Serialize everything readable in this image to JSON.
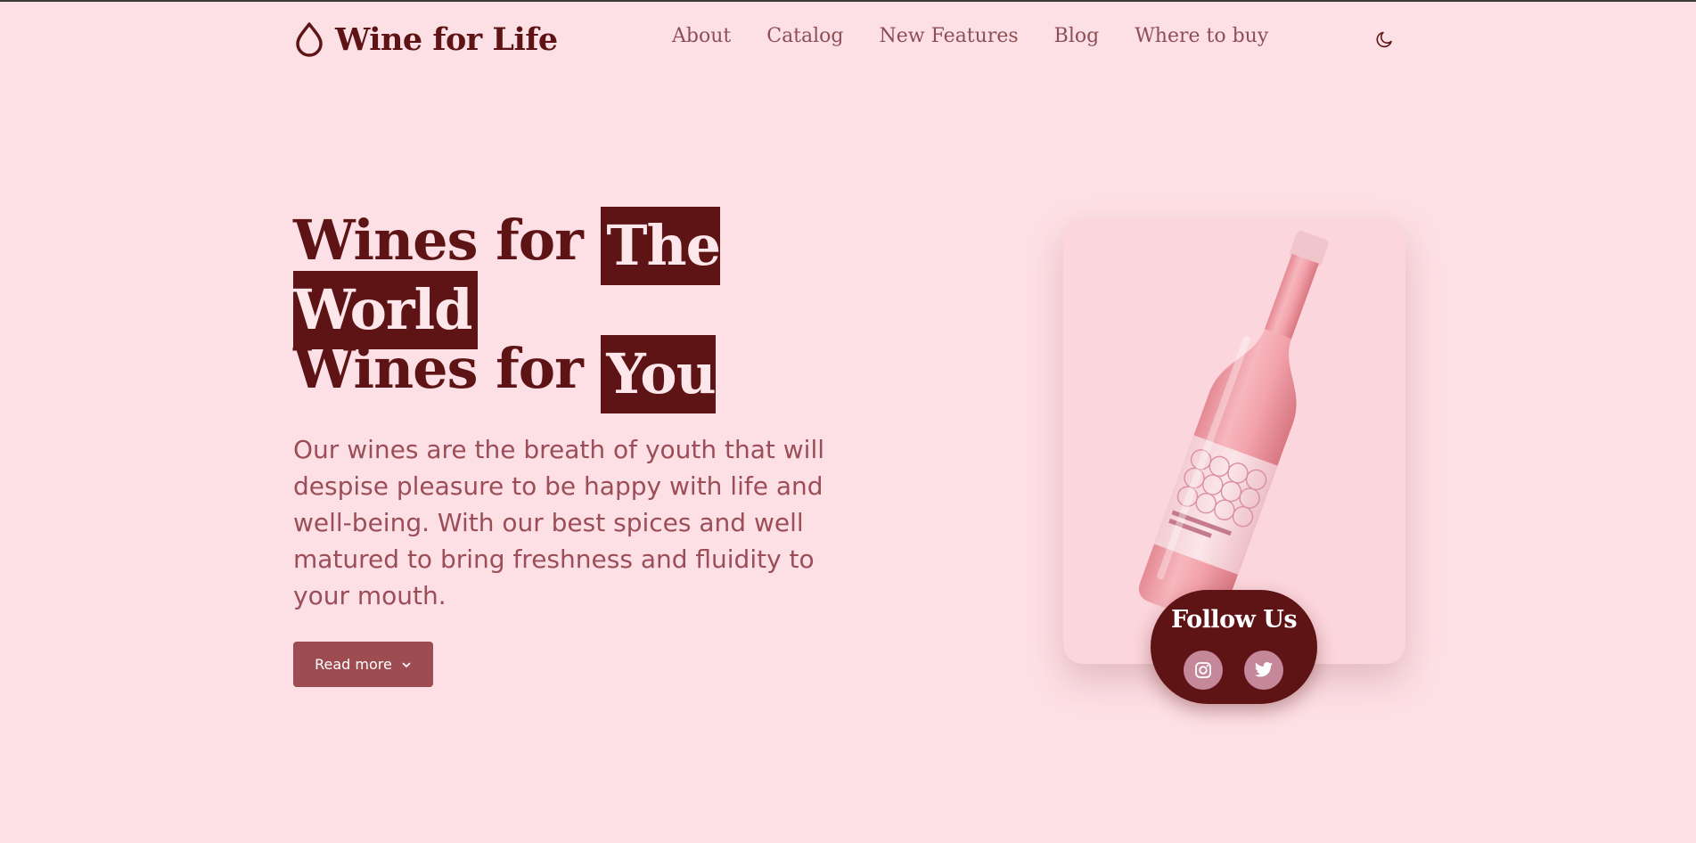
{
  "header": {
    "brand": "Wine for Life",
    "brand_icon": "drop-icon",
    "nav": [
      {
        "label": "About"
      },
      {
        "label": "Catalog"
      },
      {
        "label": "New Features"
      },
      {
        "label": "Blog"
      },
      {
        "label": "Where to buy"
      }
    ],
    "theme_toggle_icon": "moon-icon"
  },
  "hero": {
    "title_line1_prefix": "Wines for",
    "title_line1_highlight": "The",
    "title_line2_highlight": "World",
    "title_line3_prefix": "Wines for",
    "title_line3_highlight": "You",
    "description": "Our wines are the breath of youth that will despise pleasure to be happy with life and well-being. With our best spices and well matured to bring freshness and fluidity to your mouth.",
    "read_more_label": "Read more",
    "read_more_icon": "chevron-down-icon"
  },
  "product_card": {
    "image": "rose-wine-bottle",
    "follow_title": "Follow Us",
    "social": [
      {
        "icon": "instagram-icon"
      },
      {
        "icon": "twitter-icon"
      }
    ]
  },
  "colors": {
    "background": "#fde0e5",
    "brand_dark": "#5e1315",
    "text_muted": "#9b4e57",
    "button": "#9d4c51",
    "card": "#fbd6dc",
    "social_bg": "#c5879a"
  }
}
